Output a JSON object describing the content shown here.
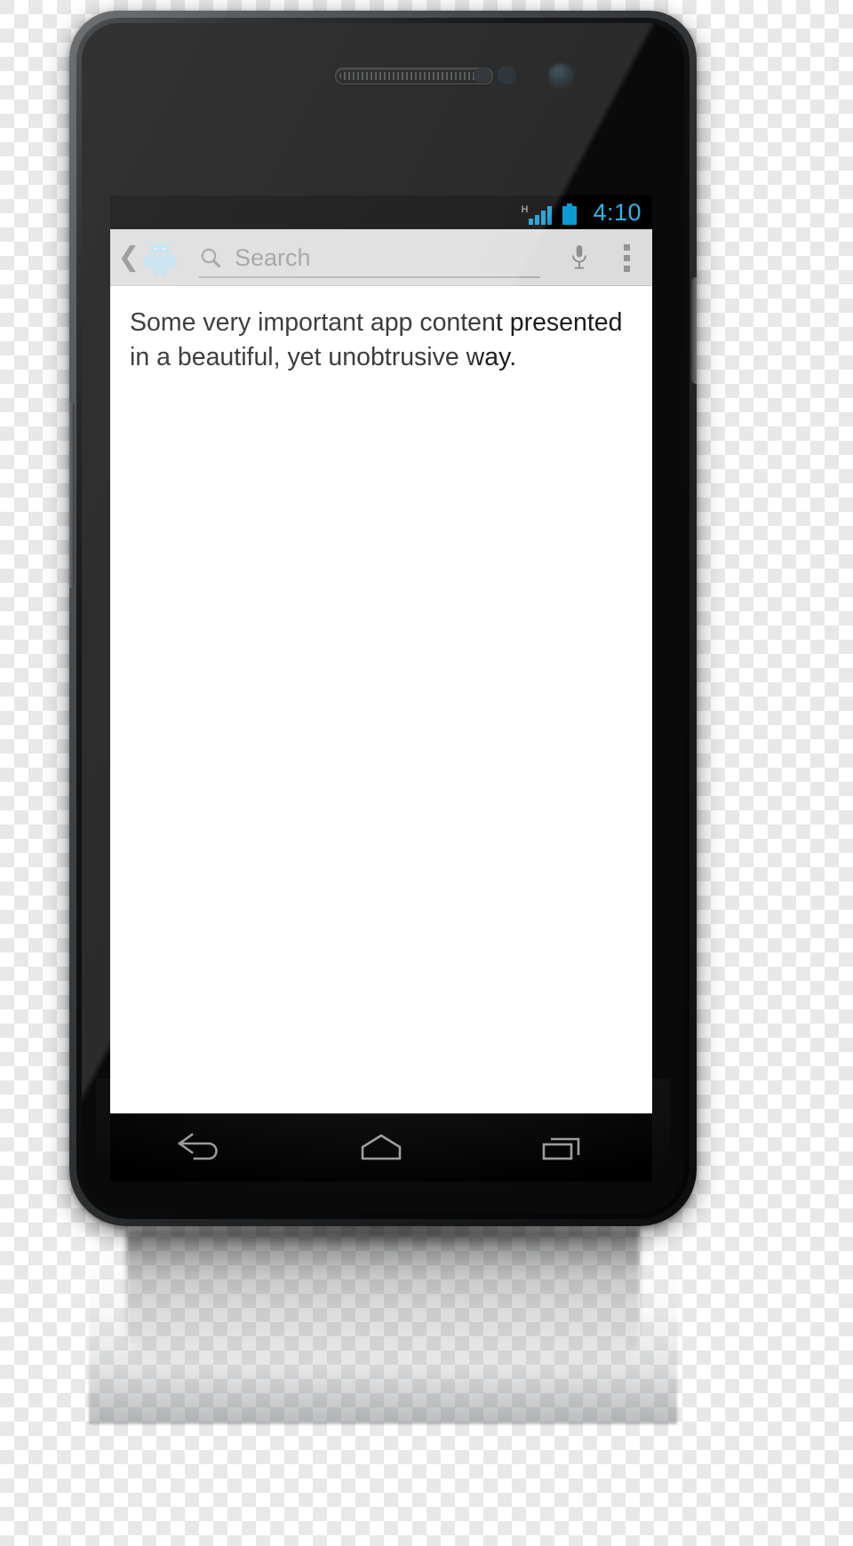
{
  "device": {
    "name": "android-phone",
    "hardware": {
      "earpiece": "earpiece-speaker",
      "proximity_sensor": "proximity-sensor",
      "light_sensor": "light-sensor",
      "front_camera": "front-camera",
      "volume_button": "volume-rocker",
      "power_button": "power-button"
    }
  },
  "status_bar": {
    "network_type": "H",
    "signal_icon": "signal-bars-icon",
    "signal_bars": 4,
    "battery_icon": "battery-full-icon",
    "time": "4:10",
    "accent_color": "#0c9bd4",
    "clock_color": "#29b6e8",
    "background_color": "#000000"
  },
  "action_bar": {
    "background_color": "#dcdcdc",
    "back_icon": "back-chevron-icon",
    "app_icon": "android-robot-icon",
    "app_icon_color": "#bfe0ef",
    "search": {
      "icon": "search-icon",
      "value": "",
      "placeholder": "Search",
      "placeholder_color": "#9a9a9a"
    },
    "voice_icon": "microphone-icon",
    "overflow_icon": "overflow-menu-icon"
  },
  "content": {
    "background_color": "#ffffff",
    "body_text": "Some very important app content presented in a beautiful, yet unobtrusive way."
  },
  "nav_bar": {
    "background_color": "#000000",
    "buttons": [
      {
        "name": "back-button",
        "icon": "nav-back-icon"
      },
      {
        "name": "home-button",
        "icon": "nav-home-icon"
      },
      {
        "name": "recents-button",
        "icon": "nav-recents-icon"
      }
    ]
  }
}
